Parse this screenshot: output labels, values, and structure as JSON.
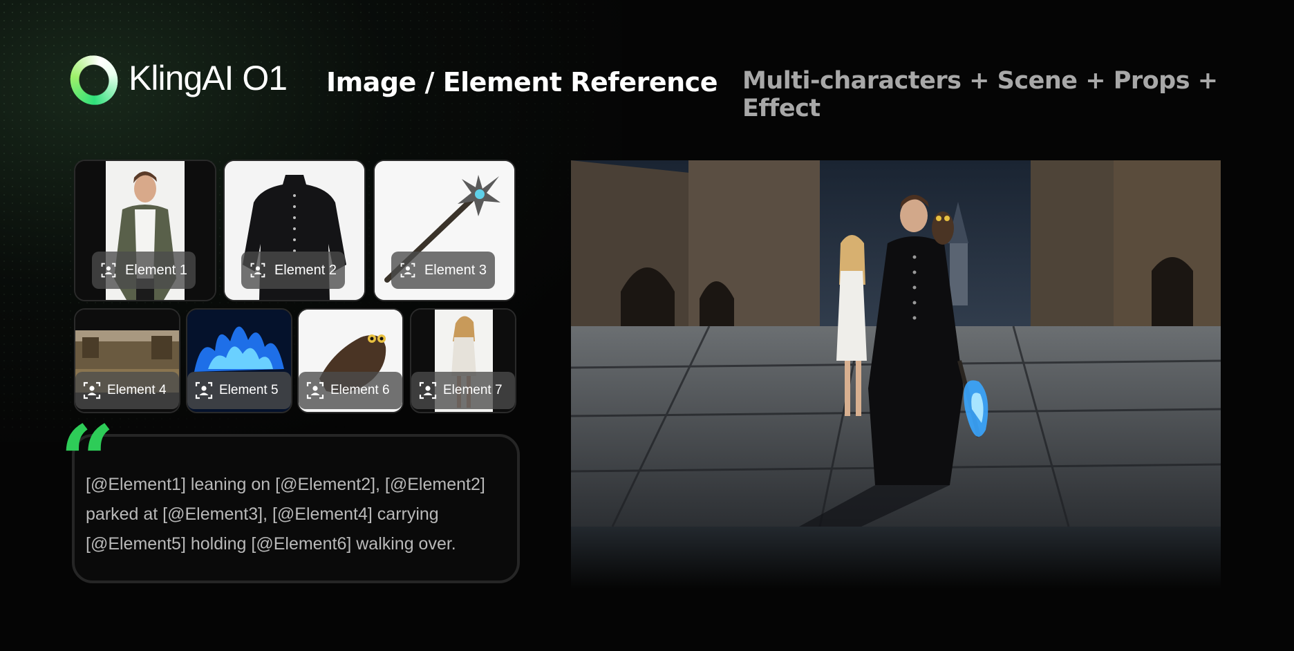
{
  "header": {
    "brand": "KlingAI O1",
    "headline": "Image / Element Reference",
    "subline": "Multi-characters + Scene  + Props + Effect"
  },
  "elements": [
    {
      "label": "Element 1",
      "icon": "person-frame-icon"
    },
    {
      "label": "Element 2",
      "icon": "person-frame-icon"
    },
    {
      "label": "Element 3",
      "icon": "person-frame-icon"
    },
    {
      "label": "Element 4",
      "icon": "person-frame-icon"
    },
    {
      "label": "Element 5",
      "icon": "person-frame-icon"
    },
    {
      "label": "Element 6",
      "icon": "person-frame-icon"
    },
    {
      "label": "Element 7",
      "icon": "person-frame-icon"
    }
  ],
  "prompt": {
    "text": "[@Element1] leaning on [@Element2], [@Element2] parked at [@Element3], [@Element4] carrying [@Element5] holding [@Element6] walking over."
  },
  "colors": {
    "accent_green": "#2ecc58",
    "subline_gray": "#a8a8a8",
    "prompt_text": "#b9b9b9"
  }
}
